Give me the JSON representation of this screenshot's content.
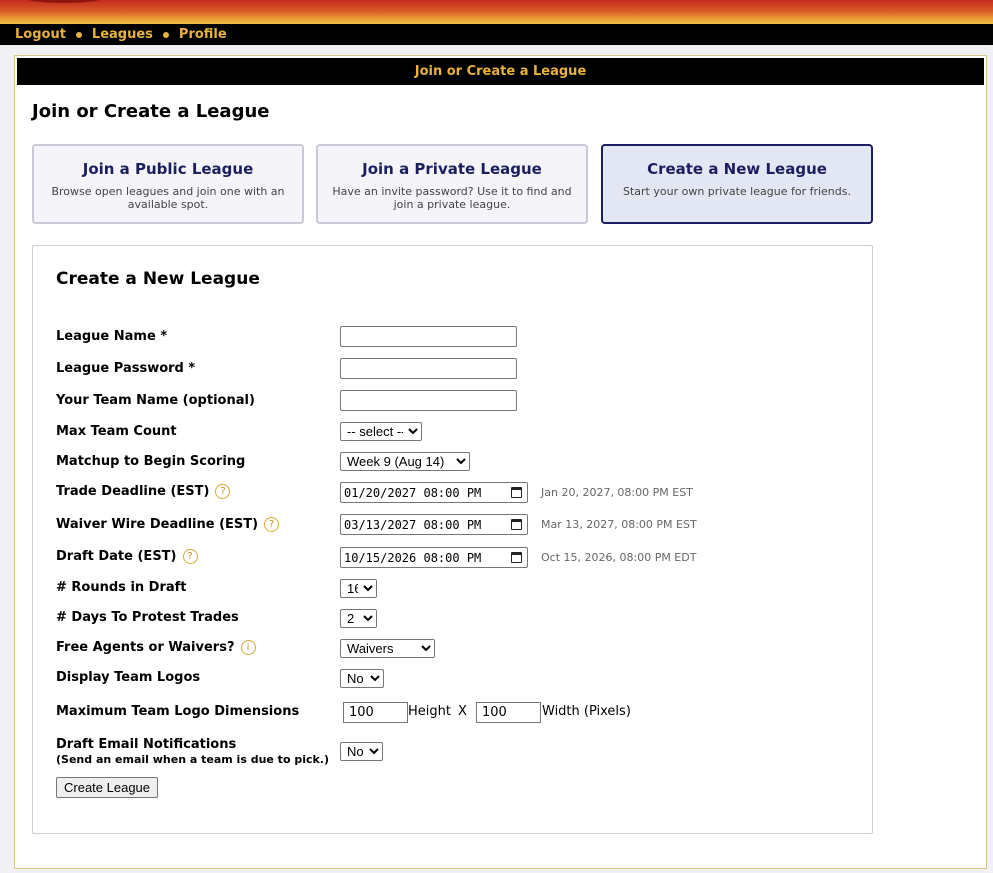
{
  "nav": {
    "items": [
      "Logout",
      "Leagues",
      "Profile"
    ]
  },
  "panel": {
    "header": "Join or Create a League"
  },
  "page": {
    "title": "Join or Create a League"
  },
  "options": [
    {
      "title": "Join a Public League",
      "desc": "Browse open leagues and join one with an available spot."
    },
    {
      "title": "Join a Private League",
      "desc": "Have an invite password? Use it to find and join a private league."
    },
    {
      "title": "Create a New League",
      "desc": "Start your own private league for friends."
    }
  ],
  "form": {
    "title": "Create a New League",
    "league_name": {
      "label": "League Name *",
      "value": ""
    },
    "league_password": {
      "label": "League Password *",
      "value": ""
    },
    "team_name": {
      "label": "Your Team Name (optional)",
      "value": ""
    },
    "max_team_count": {
      "label": "Max Team Count",
      "value": "-- select --"
    },
    "matchup_begin": {
      "label": "Matchup to Begin Scoring",
      "value": "Week 9 (Aug 14)"
    },
    "trade_deadline": {
      "label": "Trade Deadline (EST)",
      "value": "01/20/2027 08:00 PM",
      "note": "Jan 20, 2027, 08:00 PM EST"
    },
    "waiver_deadline": {
      "label": "Waiver Wire Deadline (EST)",
      "value": "03/13/2027 08:00 PM",
      "note": "Mar 13, 2027, 08:00 PM EST"
    },
    "draft_date": {
      "label": "Draft Date (EST)",
      "value": "10/15/2026 08:00 PM",
      "note": "Oct 15, 2026, 08:00 PM EDT"
    },
    "rounds": {
      "label": "# Rounds in Draft",
      "value": "16"
    },
    "protest_days": {
      "label": "# Days To Protest Trades",
      "value": "2"
    },
    "fa_or_waivers": {
      "label": "Free Agents or Waivers?",
      "value": "Waivers"
    },
    "display_logos": {
      "label": "Display Team Logos",
      "value": "No"
    },
    "logo_dims": {
      "label": "Maximum Team Logo Dimensions",
      "height": "100",
      "height_label": "Height",
      "x": "X",
      "width": "100",
      "width_label": "Width (Pixels)"
    },
    "draft_email": {
      "label": "Draft Email Notifications",
      "sublabel": "(Send an email when a team is due to pick.)",
      "value": "No"
    },
    "submit": "Create League"
  },
  "icons": {
    "help": "?",
    "info": "i"
  }
}
